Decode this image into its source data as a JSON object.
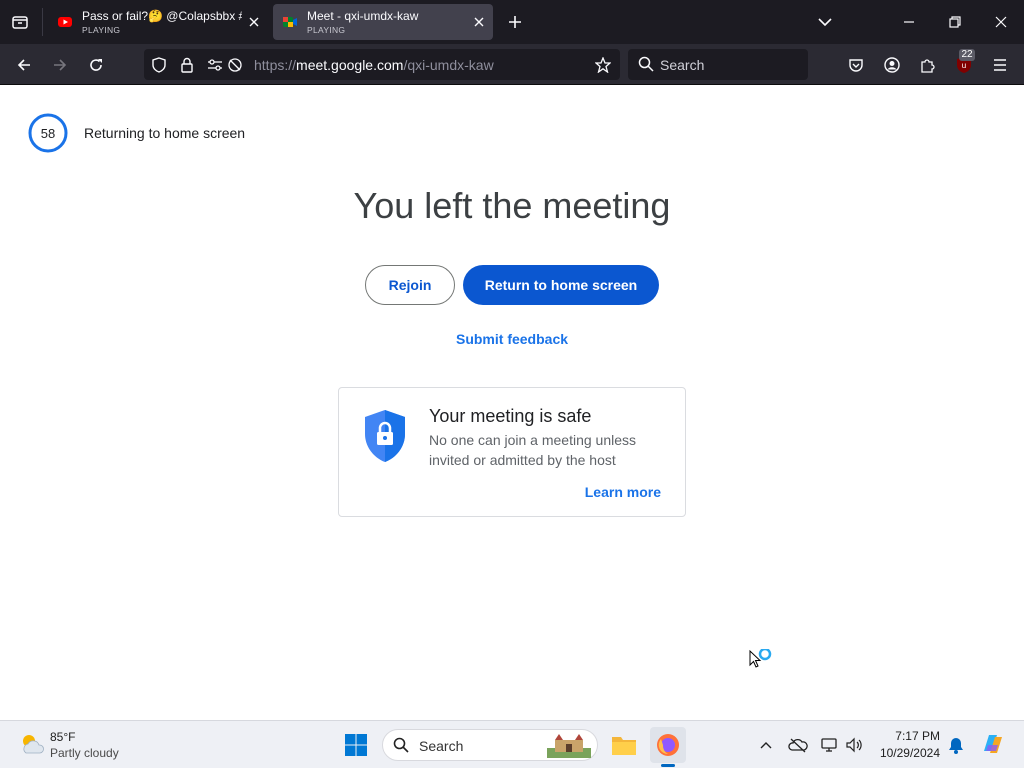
{
  "browser": {
    "tabs": [
      {
        "title": "Pass or fail?🤔 @Colapsbbx #p",
        "status": "PLAYING",
        "favicon": "youtube-icon",
        "active": false
      },
      {
        "title": "Meet - qxi-umdx-kaw",
        "status": "PLAYING",
        "favicon": "google-meet-icon",
        "active": true
      }
    ],
    "url": {
      "prefix": "https://",
      "host": "meet.google.com",
      "path": "/qxi-umdx-kaw"
    },
    "search_placeholder": "Search",
    "extension_badge": "22"
  },
  "page": {
    "countdown": "58",
    "returning_text": "Returning to home screen",
    "headline": "You left the meeting",
    "rejoin_label": "Rejoin",
    "home_label": "Return to home screen",
    "feedback_label": "Submit feedback",
    "safe_card": {
      "title": "Your meeting is safe",
      "description": "No one can join a meeting unless invited or admitted by the host",
      "learn_more": "Learn more"
    },
    "colors": {
      "primary": "#0b57d0",
      "link": "#1a73e8",
      "countdown_ring": "#1a73e8"
    }
  },
  "taskbar": {
    "weather_temp": "85°F",
    "weather_condition": "Partly cloudy",
    "search_label": "Search",
    "time": "7:17 PM",
    "date": "10/29/2024"
  }
}
